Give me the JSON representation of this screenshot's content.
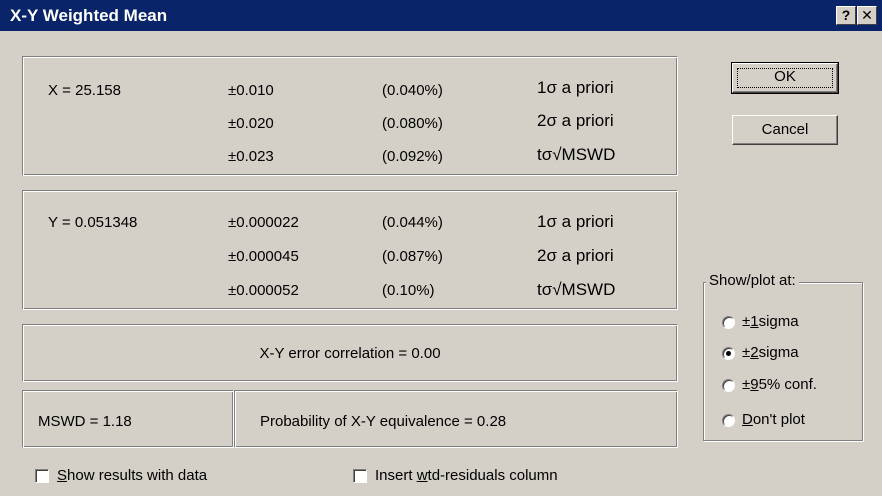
{
  "window": {
    "title": "X-Y Weighted Mean",
    "help_glyph": "?",
    "close_glyph": "✕"
  },
  "x_group": {
    "label": "X = 25.158",
    "rows": [
      {
        "err": "±0.010",
        "pct": "(0.040%)",
        "basis": "1σ a priori"
      },
      {
        "err": "±0.020",
        "pct": "(0.080%)",
        "basis": "2σ a priori"
      },
      {
        "err": "±0.023",
        "pct": "(0.092%)",
        "basis": "tσ√MSWD"
      }
    ]
  },
  "y_group": {
    "label": "Y = 0.051348",
    "rows": [
      {
        "err": "±0.000022",
        "pct": "(0.044%)",
        "basis": "1σ a priori"
      },
      {
        "err": "±0.000045",
        "pct": "(0.087%)",
        "basis": "2σ a priori"
      },
      {
        "err": "±0.000052",
        "pct": "(0.10%)",
        "basis": "tσ√MSWD"
      }
    ]
  },
  "correlation": "X-Y error correlation = 0.00",
  "mswd": "MSWD = 1.18",
  "probability": "Probability of X-Y equivalence = 0.28",
  "buttons": {
    "ok": "OK",
    "cancel": "Cancel"
  },
  "plot_options": {
    "legend": "Show/plot at:",
    "options": [
      {
        "pre": "±",
        "key": "1",
        "post": "sigma",
        "selected": false
      },
      {
        "pre": "±",
        "key": "2",
        "post": "sigma",
        "selected": true
      },
      {
        "pre": "±",
        "key": "9",
        "post": "5% conf.",
        "selected": false
      },
      {
        "pre": "",
        "key": "D",
        "post": "on't plot",
        "selected": false
      }
    ]
  },
  "checkboxes": {
    "show_results": {
      "pre": "",
      "key": "S",
      "post": "how results with data",
      "checked": false
    },
    "insert_residuals": {
      "pre": "Insert ",
      "key": "w",
      "post": "td-residuals column",
      "checked": false
    }
  }
}
